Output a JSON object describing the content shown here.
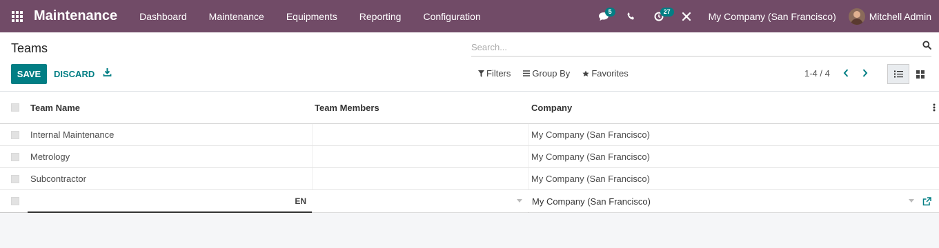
{
  "navbar": {
    "app_title": "Maintenance",
    "menu": [
      "Dashboard",
      "Maintenance",
      "Equipments",
      "Reporting",
      "Configuration"
    ],
    "messages_count": "5",
    "activities_count": "27",
    "company": "My Company (San Francisco)",
    "user": "Mitchell Admin",
    "bg_color": "#714b67"
  },
  "control_panel": {
    "breadcrumb": "Teams",
    "search_placeholder": "Search...",
    "save_label": "SAVE",
    "discard_label": "DISCARD",
    "filters_label": "Filters",
    "groupby_label": "Group By",
    "favorites_label": "Favorites",
    "pager": "1-4 / 4",
    "accent_color": "#017e84"
  },
  "table": {
    "headers": {
      "name": "Team Name",
      "members": "Team Members",
      "company": "Company"
    },
    "rows": [
      {
        "name": "Internal Maintenance",
        "members": "",
        "company": "My Company (San Francisco)"
      },
      {
        "name": "Metrology",
        "members": "",
        "company": "My Company (San Francisco)"
      },
      {
        "name": "Subcontractor",
        "members": "",
        "company": "My Company (San Francisco)"
      }
    ],
    "new_row": {
      "name": "",
      "lang_tag": "EN",
      "members": "",
      "company": "My Company (San Francisco)"
    }
  }
}
